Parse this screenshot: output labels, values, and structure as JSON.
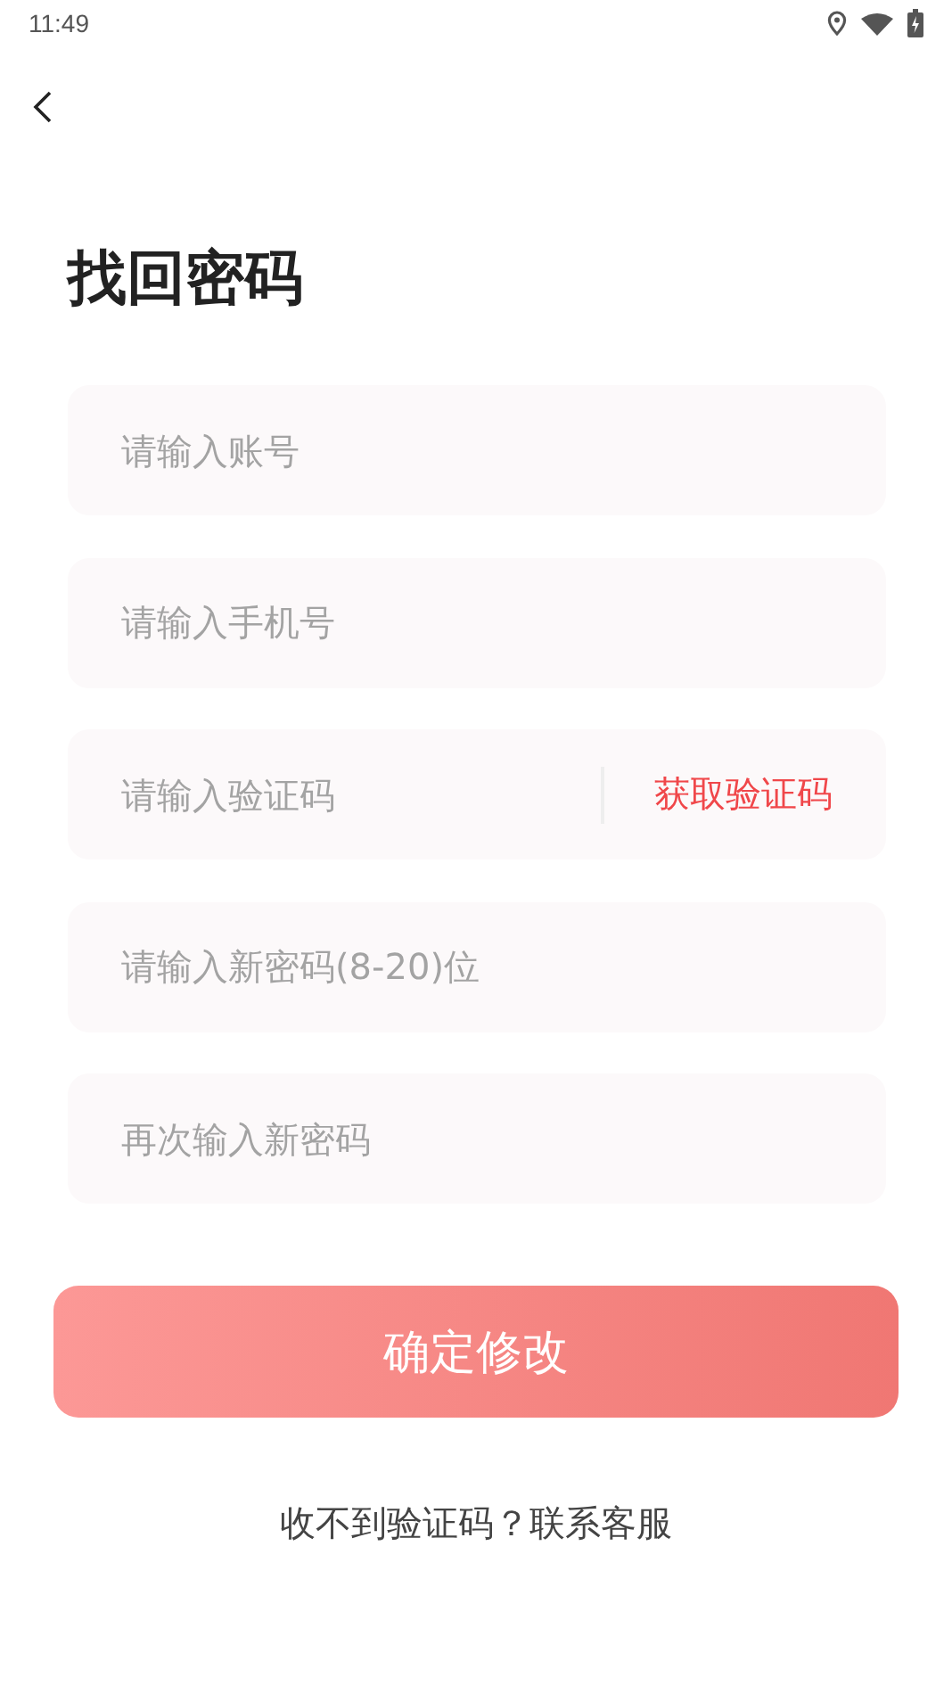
{
  "status_bar": {
    "time": "11:49"
  },
  "title": "找回密码",
  "fields": [
    {
      "kind": "text",
      "placeholder": "请输入账号"
    },
    {
      "kind": "text",
      "placeholder": "请输入手机号"
    },
    {
      "kind": "code",
      "placeholder": "请输入验证码",
      "action": "获取验证码"
    },
    {
      "kind": "password",
      "placeholder": "请输入新密码(8-20)位"
    },
    {
      "kind": "password",
      "placeholder": "再次输入新密码"
    }
  ],
  "submit": "确定修改",
  "help_link": "收不到验证码？联系客服"
}
